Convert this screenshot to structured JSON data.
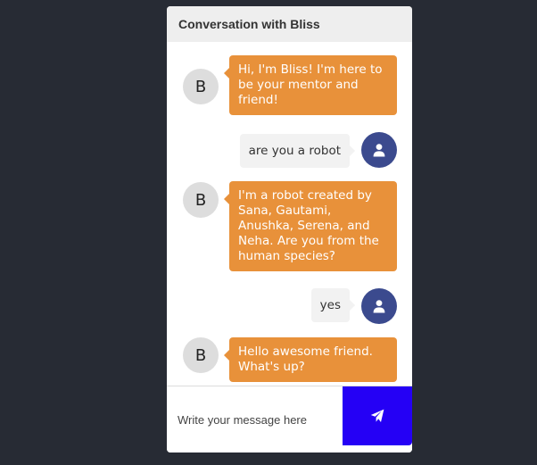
{
  "header": {
    "title": "Conversation with Bliss"
  },
  "bot": {
    "avatar_letter": "B"
  },
  "messages": [
    {
      "sender": "bot",
      "text": "Hi, I'm Bliss! I'm here to be your mentor and friend!"
    },
    {
      "sender": "user",
      "text": "are you a robot"
    },
    {
      "sender": "bot",
      "text": "I'm a robot created by Sana, Gautami, Anushka, Serena, and Neha. Are you from the human species?"
    },
    {
      "sender": "user",
      "text": "yes"
    },
    {
      "sender": "bot",
      "text": "Hello awesome friend. What's up?"
    }
  ],
  "composer": {
    "placeholder": "Write your message here",
    "value": ""
  },
  "icons": {
    "user_avatar": "user-icon",
    "send": "paper-plane-icon"
  },
  "colors": {
    "background": "#272b34",
    "bot_bubble": "#e8913a",
    "user_bubble": "#f2f2f2",
    "user_avatar": "#3b4a8e",
    "send_button": "#2500f5"
  }
}
